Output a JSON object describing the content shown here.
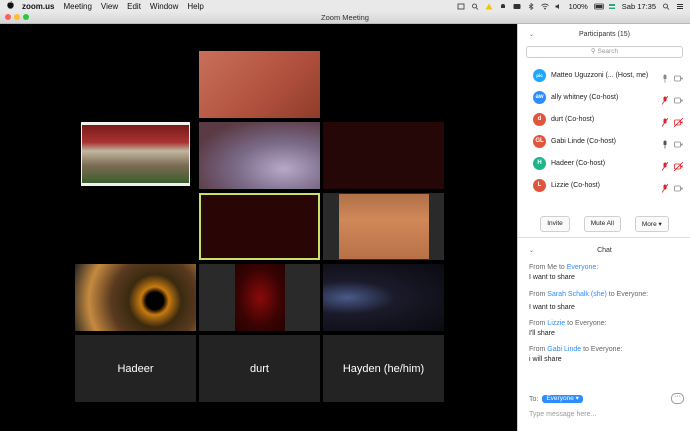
{
  "menubar": {
    "app": "zoom.us",
    "items": [
      "Meeting",
      "View",
      "Edit",
      "Window",
      "Help"
    ],
    "battery": "100%",
    "clock": "Sab 17:35"
  },
  "window": {
    "title": "Zoom Meeting"
  },
  "tiles": {
    "hadeer": "Hadeer",
    "durt": "durt",
    "hayden": "Hayden (he/him)"
  },
  "participants": {
    "title": "Participants (15)",
    "search_placeholder": "Search",
    "rows": [
      {
        "name": "Matteo Uguzzoni (...  (Host, me)",
        "initials": "pic",
        "color": "#1ea7ff"
      },
      {
        "name": "ally whitney (Co-host)",
        "initials": "aw",
        "color": "#2d8cff"
      },
      {
        "name": "durt (Co-host)",
        "initials": "d",
        "color": "#e0553d"
      },
      {
        "name": "Gabi Linde (Co-host)",
        "initials": "GL",
        "color": "#e0553d"
      },
      {
        "name": "Hadeer  (Co-host)",
        "initials": "H",
        "color": "#1fb58a"
      },
      {
        "name": "Lizzie (Co-host)",
        "initials": "L",
        "color": "#e0553d"
      }
    ],
    "invite": "Invite",
    "mute_all": "Mute All",
    "more": "More"
  },
  "chat": {
    "title": "Chat",
    "messages": [
      {
        "from_prefix": "From Me to",
        "sender": "",
        "to": "Everyone:",
        "text": "I want to share"
      },
      {
        "from_prefix": "From",
        "sender": "Sarah Schalk (she)",
        "to": "to Everyone:",
        "text": "I want to share"
      },
      {
        "from_prefix": "From",
        "sender": "Lizzie",
        "to": "to Everyone:",
        "text": "I'll share"
      },
      {
        "from_prefix": "From",
        "sender": "Gabi Linde",
        "to": "to Everyone:",
        "text": "i will share"
      }
    ],
    "to_label": "To:",
    "to_value": "Everyone",
    "input_placeholder": "Type message here..."
  }
}
